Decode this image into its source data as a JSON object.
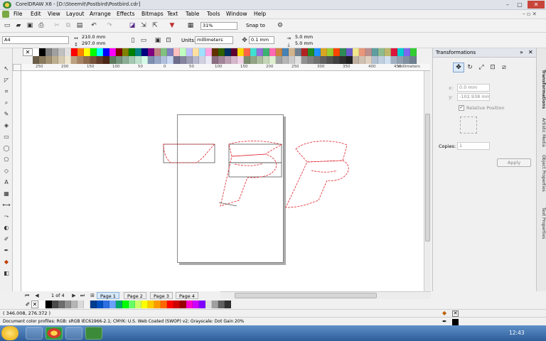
{
  "window": {
    "title": "CorelDRAW X6 - [D:\\Steemit\\Postbird\\Postbird.cdr]"
  },
  "menu": [
    "File",
    "Edit",
    "View",
    "Layout",
    "Arrange",
    "Effects",
    "Bitmaps",
    "Text",
    "Table",
    "Tools",
    "Window",
    "Help"
  ],
  "toolbar": {
    "zoom": "31%",
    "snap_to": "Snap to"
  },
  "property_bar": {
    "page_size": "A4",
    "width": "210.0 mm",
    "height": "297.0 mm",
    "units_label": "Units:",
    "units_value": "millimeters",
    "nudge": "0.1 mm",
    "dup_x": "5.0 mm",
    "dup_y": "5.0 mm"
  },
  "ruler": {
    "unit": "millimeters",
    "ticks": [
      "250",
      "200",
      "150",
      "100",
      "50",
      "0",
      "50",
      "100",
      "150",
      "200",
      "250",
      "300",
      "350",
      "400",
      "450"
    ]
  },
  "pages": {
    "counter": "1 of 4",
    "tabs": [
      "Page 1",
      "Page 2",
      "Page 3",
      "Page 4"
    ],
    "active": 0
  },
  "docker": {
    "title": "Transformations",
    "x_value": "0.0 mm",
    "y_value": "-102.938 mm",
    "relative_label": "Relative Position",
    "copies_label": "Copies:",
    "copies_value": "1",
    "apply_label": "Apply",
    "side_tabs": [
      "Transformations",
      "Artistic Media",
      "Object Properties",
      "Text Properties"
    ]
  },
  "status": {
    "coords": "( 346.008, 276.372 )",
    "color_profile": "Document color profiles: RGB: sRGB IEC61966-2.1; CMYK: U.S. Web Coated (SWOP) v2; Grayscale: Dot Gain 20%"
  },
  "taskbar": {
    "time": "12:43"
  },
  "colors": {
    "palette_top": [
      "#ffffff",
      "#000000",
      "#7f7f7f",
      "#a0a0a0",
      "#c0c0c0",
      "#e0e0e0",
      "#ff0000",
      "#ff8000",
      "#ffff00",
      "#00ff00",
      "#00ffff",
      "#0000ff",
      "#ff00ff",
      "#800000",
      "#808000",
      "#008000",
      "#008080",
      "#000080",
      "#800080",
      "#c08080",
      "#80c080",
      "#8080c0",
      "#ffc0c0",
      "#c0ffc0",
      "#c0c0ff",
      "#ffe0a0",
      "#a0e0ff",
      "#ffa0e0",
      "#603000",
      "#306000",
      "#003060",
      "#600030",
      "#ffd700",
      "#ff6347",
      "#40e0d0",
      "#9370db",
      "#3cb371",
      "#ff69b4",
      "#cd853f",
      "#4682b4",
      "#d2b48c",
      "#708090",
      "#b22222",
      "#228b22",
      "#1e90ff",
      "#daa520",
      "#9acd32",
      "#ff4500",
      "#2e8b57",
      "#6a5acd",
      "#f0e68c",
      "#e9967a",
      "#bc8f8f",
      "#5f9ea0",
      "#8fbc8f",
      "#bdb76b",
      "#dc143c",
      "#00ced1",
      "#7b68ee",
      "#32cd32"
    ],
    "palette_bottom": [
      "#6b5e49",
      "#8a7b5e",
      "#a39174",
      "#bcae8f",
      "#d6cbb0",
      "#efe6d0",
      "#bda07f",
      "#a68365",
      "#8f6a4c",
      "#78513a",
      "#613b28",
      "#4a2616",
      "#5c7a5e",
      "#73937a",
      "#8bad95",
      "#a3c7b0",
      "#bce0cb",
      "#d4f9e6",
      "#7f8fb0",
      "#97a7c6",
      "#b0bfdc",
      "#c8d7f2",
      "#6d6d8a",
      "#85859f",
      "#9e9eb5",
      "#b7b7cb",
      "#d0d0e1",
      "#e9e9f6",
      "#8a6d80",
      "#a38599",
      "#bc9eb2",
      "#d5b7cb",
      "#eed0e4",
      "#7a8a6d",
      "#93a385",
      "#acbc9e",
      "#c5d5b7",
      "#def0d0",
      "#a0a0a0",
      "#b5b5b5",
      "#cacaca",
      "#dfdfdf",
      "#909090",
      "#808080",
      "#707070",
      "#606060",
      "#505050",
      "#404040",
      "#303030",
      "#202020",
      "#c0b0a0",
      "#d0c0b0",
      "#e0d0c0",
      "#b0c0d0",
      "#c0d0e0",
      "#d0e0f0",
      "#a0b0c0",
      "#90a0b0",
      "#8090a0",
      "#708090"
    ],
    "palette_doc": [
      "#ffffff",
      "#000000",
      "#4a4a4a",
      "#6d6d6d",
      "#919191",
      "#b5b5b5",
      "#dadada",
      "#f3f3f3",
      "#003c8f",
      "#0050c0",
      "#2d6ee0",
      "#6aa0ff",
      "#00a86b",
      "#00ff00",
      "#66ff66",
      "#ccff66",
      "#ffff00",
      "#ffcc00",
      "#ff9900",
      "#ff6600",
      "#ff0000",
      "#cc0000",
      "#990000",
      "#ff00cc",
      "#cc00ff",
      "#8000ff",
      "#e0e0e0",
      "#a0a0a0",
      "#606060",
      "#303030"
    ],
    "accent": "#d7e8f8",
    "outline_red": "#e0202a"
  }
}
